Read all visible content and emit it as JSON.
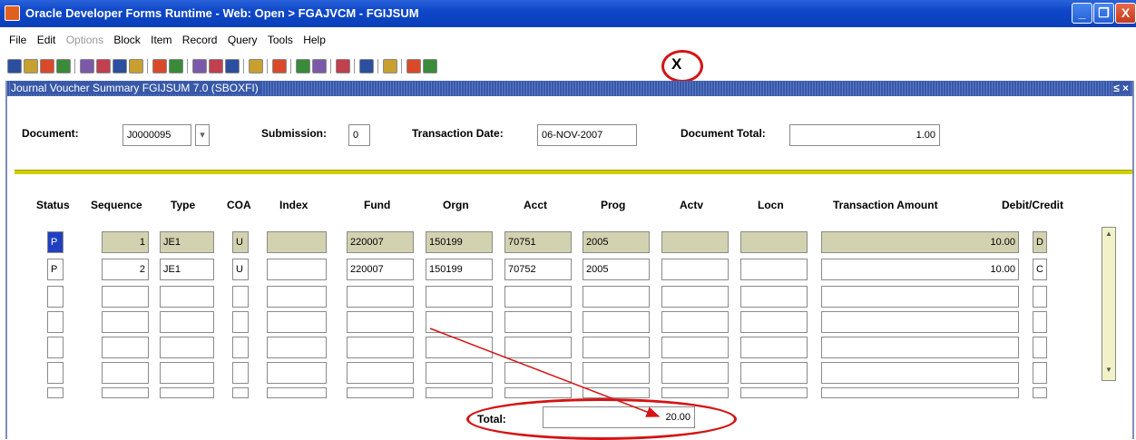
{
  "window": {
    "title": "Oracle Developer Forms Runtime - Web:  Open > FGAJVCM - FGIJSUM",
    "minimize_glyph": "_",
    "restore_glyph": "❐",
    "close_glyph": "X"
  },
  "menu": [
    "File",
    "Edit",
    "Options",
    "Block",
    "Item",
    "Record",
    "Query",
    "Tools",
    "Help"
  ],
  "toolbar": {
    "exit_label": "X",
    "button_icons": [
      "save-icon",
      "rollback-icon",
      "print-icon",
      "enter-query-icon",
      "execute-query-icon",
      "cancel-query-icon",
      "count-query-icon",
      "previous-block-icon",
      "next-block-icon",
      "previous-record-icon",
      "next-record-icon",
      "insert-record-icon",
      "remove-record-icon",
      "lock-record-icon",
      "duplicate-field-icon",
      "clear-record-icon",
      "edit-icon",
      "list-values-icon",
      "help-icon",
      "show-keys-icon",
      "options-icon",
      "hint-icon"
    ]
  },
  "form": {
    "title": "Journal Voucher Summary  FGIJSUM  7.0  (SBOXFI)",
    "controls": "≤ ×",
    "key": {
      "document_label": "Document:",
      "document_value": "J0000095",
      "dropdown_glyph": "▾",
      "submission_label": "Submission:",
      "submission_value": "0",
      "transaction_date_label": "Transaction Date:",
      "transaction_date_value": "06-NOV-2007",
      "document_total_label": "Document Total:",
      "document_total_value": "1.00"
    },
    "columns": [
      "Status",
      "Sequence",
      "Type",
      "COA",
      "Index",
      "Fund",
      "Orgn",
      "Acct",
      "Prog",
      "Actv",
      "Locn",
      "Transaction Amount",
      "Debit/Credit"
    ],
    "rows": [
      {
        "status": "P",
        "sequence": "1",
        "type": "JE1",
        "coa": "U",
        "index": "",
        "fund": "220007",
        "orgn": "150199",
        "acct": "70751",
        "prog": "2005",
        "actv": "",
        "locn": "",
        "amount": "10.00",
        "dc": "D"
      },
      {
        "status": "P",
        "sequence": "2",
        "type": "JE1",
        "coa": "U",
        "index": "",
        "fund": "220007",
        "orgn": "150199",
        "acct": "70752",
        "prog": "2005",
        "actv": "",
        "locn": "",
        "amount": "10.00",
        "dc": "C"
      },
      {
        "status": "",
        "sequence": "",
        "type": "",
        "coa": "",
        "index": "",
        "fund": "",
        "orgn": "",
        "acct": "",
        "prog": "",
        "actv": "",
        "locn": "",
        "amount": "",
        "dc": ""
      },
      {
        "status": "",
        "sequence": "",
        "type": "",
        "coa": "",
        "index": "",
        "fund": "",
        "orgn": "",
        "acct": "",
        "prog": "",
        "actv": "",
        "locn": "",
        "amount": "",
        "dc": ""
      },
      {
        "status": "",
        "sequence": "",
        "type": "",
        "coa": "",
        "index": "",
        "fund": "",
        "orgn": "",
        "acct": "",
        "prog": "",
        "actv": "",
        "locn": "",
        "amount": "",
        "dc": ""
      },
      {
        "status": "",
        "sequence": "",
        "type": "",
        "coa": "",
        "index": "",
        "fund": "",
        "orgn": "",
        "acct": "",
        "prog": "",
        "actv": "",
        "locn": "",
        "amount": "",
        "dc": ""
      },
      {
        "status": "",
        "sequence": "",
        "type": "",
        "coa": "",
        "index": "",
        "fund": "",
        "orgn": "",
        "acct": "",
        "prog": "",
        "actv": "",
        "locn": "",
        "amount": "",
        "dc": ""
      }
    ],
    "total_label": "Total:",
    "total_value": "20.00"
  },
  "annotation_color": "#d41414"
}
